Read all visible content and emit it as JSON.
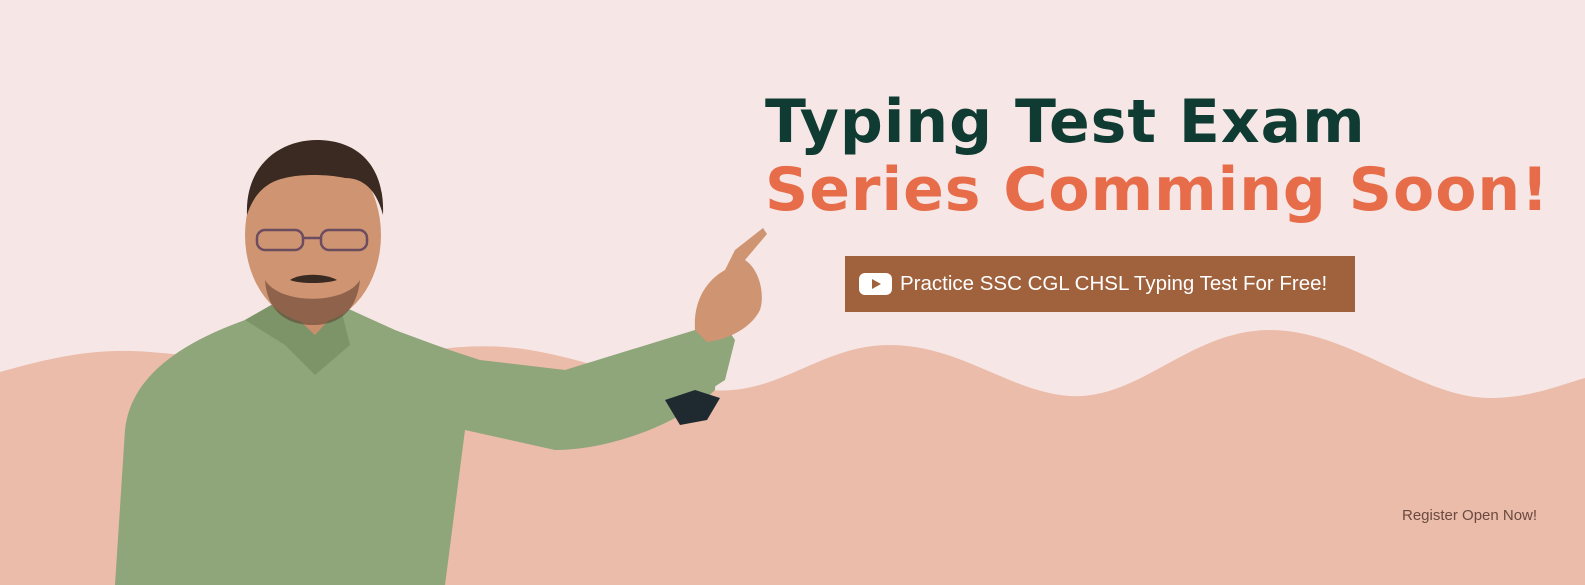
{
  "banner": {
    "headline_line1": "Typing Test Exam",
    "headline_line2": "Series Comming Soon!",
    "cta_icon": "youtube-play-icon",
    "cta_label": "Practice SSC CGL CHSL Typing Test For Free!",
    "register_text": "Register Open Now!"
  },
  "colors": {
    "background": "#f6e7e6",
    "wave": "#ebbca9",
    "headline_dark": "#0f3b32",
    "headline_accent": "#e76d4a",
    "cta_background": "#a0613d",
    "shirt": "#8fa57a"
  }
}
